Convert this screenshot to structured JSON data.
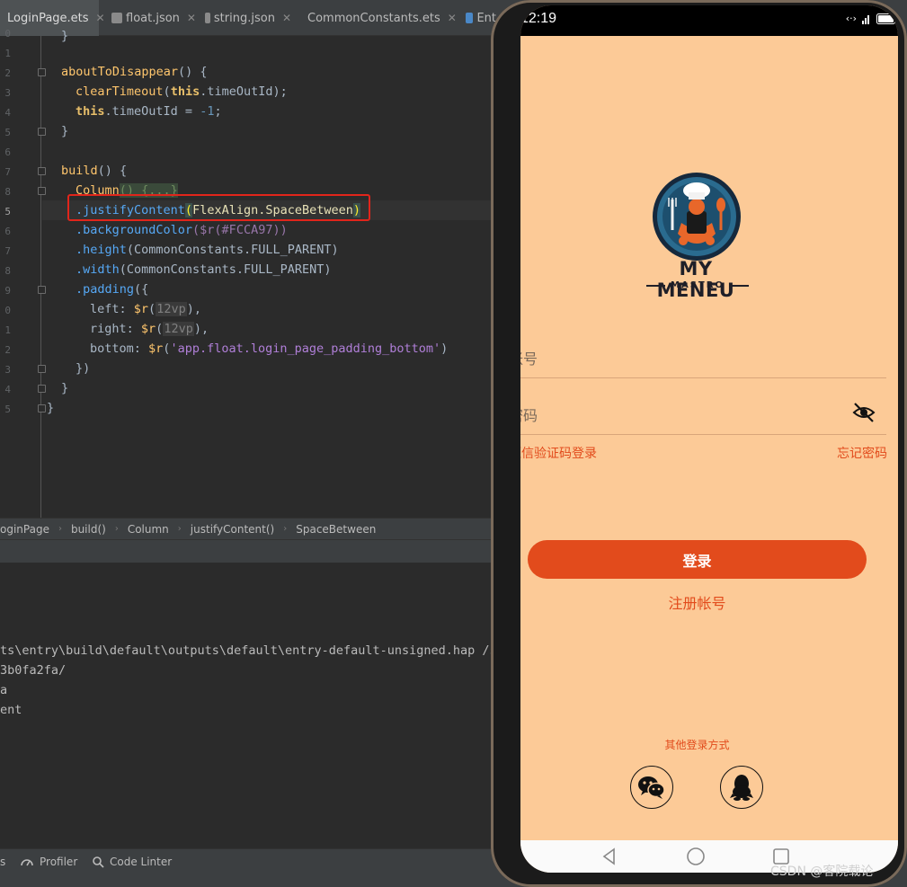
{
  "ide": {
    "tabs": [
      {
        "label": "LoginPage.ets",
        "icon": "ets-file-icon"
      },
      {
        "label": "float.json",
        "icon": "json-file-icon"
      },
      {
        "label": "string.json",
        "icon": "json-file-icon"
      },
      {
        "label": "CommonConstants.ets",
        "icon": "ets-file-icon"
      },
      {
        "label": "Ent",
        "icon": "ets-file-icon"
      }
    ],
    "line_numbers": [
      "0",
      "1",
      "2",
      "3",
      "4",
      "5",
      "6",
      "7",
      "8",
      "5",
      "6",
      "7",
      "8",
      "9",
      "0",
      "1",
      "2",
      "3",
      "4",
      "5"
    ],
    "code": {
      "l0": "}",
      "l2_fn": "aboutToDisappear",
      "l2_rest": "() {",
      "l3_fn": "clearTimeout",
      "l3_kw": "this",
      "l3_rest": ".timeOutId);",
      "l4_kw": "this",
      "l4_mid": ".timeOutId = ",
      "l4_num": "-1",
      "l4_end": ";",
      "l5": "}",
      "l7_fn": "build",
      "l7_rest": "() {",
      "l8_fn": "Column",
      "l8_rest": "() {...}",
      "l9_method": ".justifyContent",
      "l9_open": "(",
      "l9_arg": "FlexAlign.SpaceBetween",
      "l9_close": ")",
      "l10_method": ".backgroundColor",
      "l10_rest": "($r(#FCCA97))",
      "l11_method": ".height",
      "l11_rest": "(CommonConstants.FULL_PARENT)",
      "l12_method": ".width",
      "l12_rest": "(CommonConstants.FULL_PARENT)",
      "l13_method": ".padding",
      "l13_rest": "({",
      "l14_key": "left: ",
      "l14_r": "$r",
      "l14_val": "12vp",
      "l15_key": "right: ",
      "l15_r": "$r",
      "l15_val": "12vp",
      "l16_key": "bottom: ",
      "l16_r": "$r",
      "l16_str": "'app.float.login_page_padding_bottom'",
      "l17": "})",
      "l18": "}",
      "l19": "}"
    },
    "breadcrumbs": [
      "oginPage",
      "build()",
      "Column",
      "justifyContent()",
      "SpaceBetween"
    ],
    "console": [
      "ts\\entry\\build\\default\\outputs\\default\\entry-default-unsigned.hap /sc",
      "3b0fa2fa/",
      "a",
      "ent"
    ],
    "status_items": [
      "s",
      "Profiler",
      "Code Linter"
    ]
  },
  "phone": {
    "time": "12:19",
    "brand_title": "MY MENEU",
    "brand_subtitle": "MASTRO",
    "account_placeholder": "帐号",
    "password_placeholder": "密码",
    "sms_login": "短信验证码登录",
    "forgot_password": "忘记密码",
    "login_button": "登录",
    "register_link": "注册帐号",
    "other_login": "其他登录方式",
    "colors": {
      "background": "#FCCA97",
      "accent": "#E24B1C"
    }
  },
  "watermark": "CSDN @客院载论"
}
